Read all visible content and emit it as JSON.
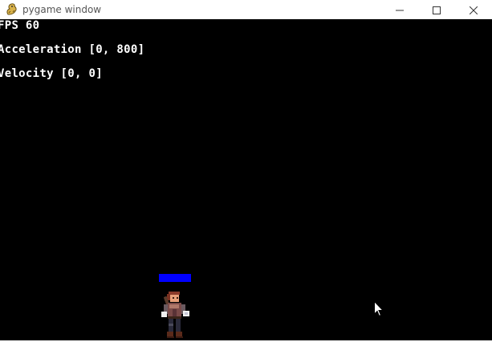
{
  "window": {
    "title": "pygame window",
    "icon": "pygame-snake-icon",
    "controls": {
      "minimize_icon": "minimize-icon",
      "maximize_icon": "maximize-icon",
      "close_icon": "close-icon"
    }
  },
  "hud": {
    "fps": "FPS 60",
    "acceleration": "Acceleration [0, 800]",
    "velocity": "Velocity [0, 0]"
  },
  "player": {
    "sprite": "pixel-character-sprite",
    "health_fraction": 1.0,
    "health_color": "#0000ff"
  },
  "colors": {
    "background": "#000000",
    "hud_text": "#ffffff",
    "titlebar": "#ffffff"
  }
}
